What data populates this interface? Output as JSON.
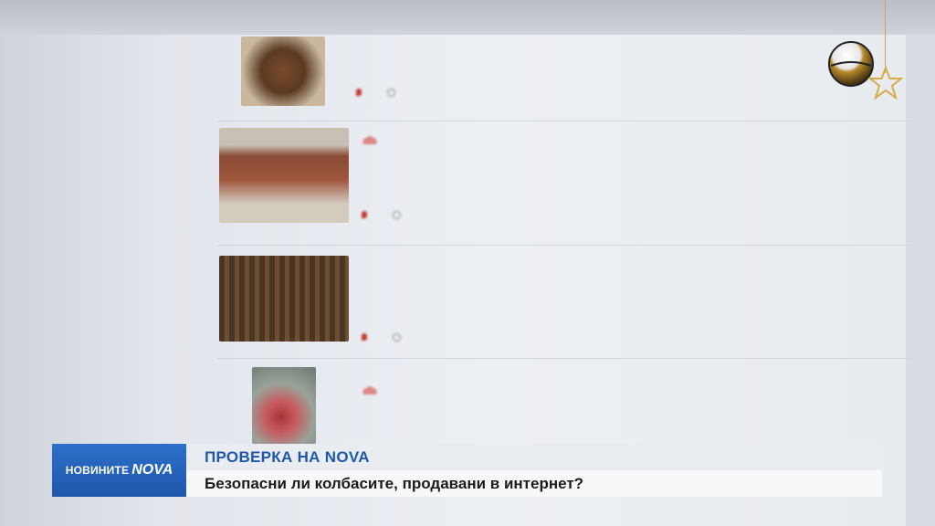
{
  "lower_third": {
    "brand_text": "НОВИНИТЕ",
    "brand_mark": "NOVA",
    "headline": "ПРОВЕРКА НА NOVA",
    "subheadline": "Безопасни ли колбасите, продавани в интернет?"
  },
  "listings": [
    {
      "title": "",
      "subtitle": "",
      "location": "",
      "time": ""
    },
    {
      "title": "",
      "subtitle": "",
      "location": "",
      "time": ""
    },
    {
      "title": "",
      "subtitle": "",
      "location": "",
      "time": ""
    },
    {
      "title": "",
      "subtitle": "",
      "location": "",
      "time": ""
    }
  ],
  "colors": {
    "brand_blue": "#1f58ab",
    "link_blue": "#3f6fb6",
    "banner_light": "#e9edf2"
  },
  "icons": [
    "logo-sphere-icon",
    "star-ornament-icon",
    "location-pin-icon",
    "clock-icon",
    "chef-hat-icon"
  ]
}
